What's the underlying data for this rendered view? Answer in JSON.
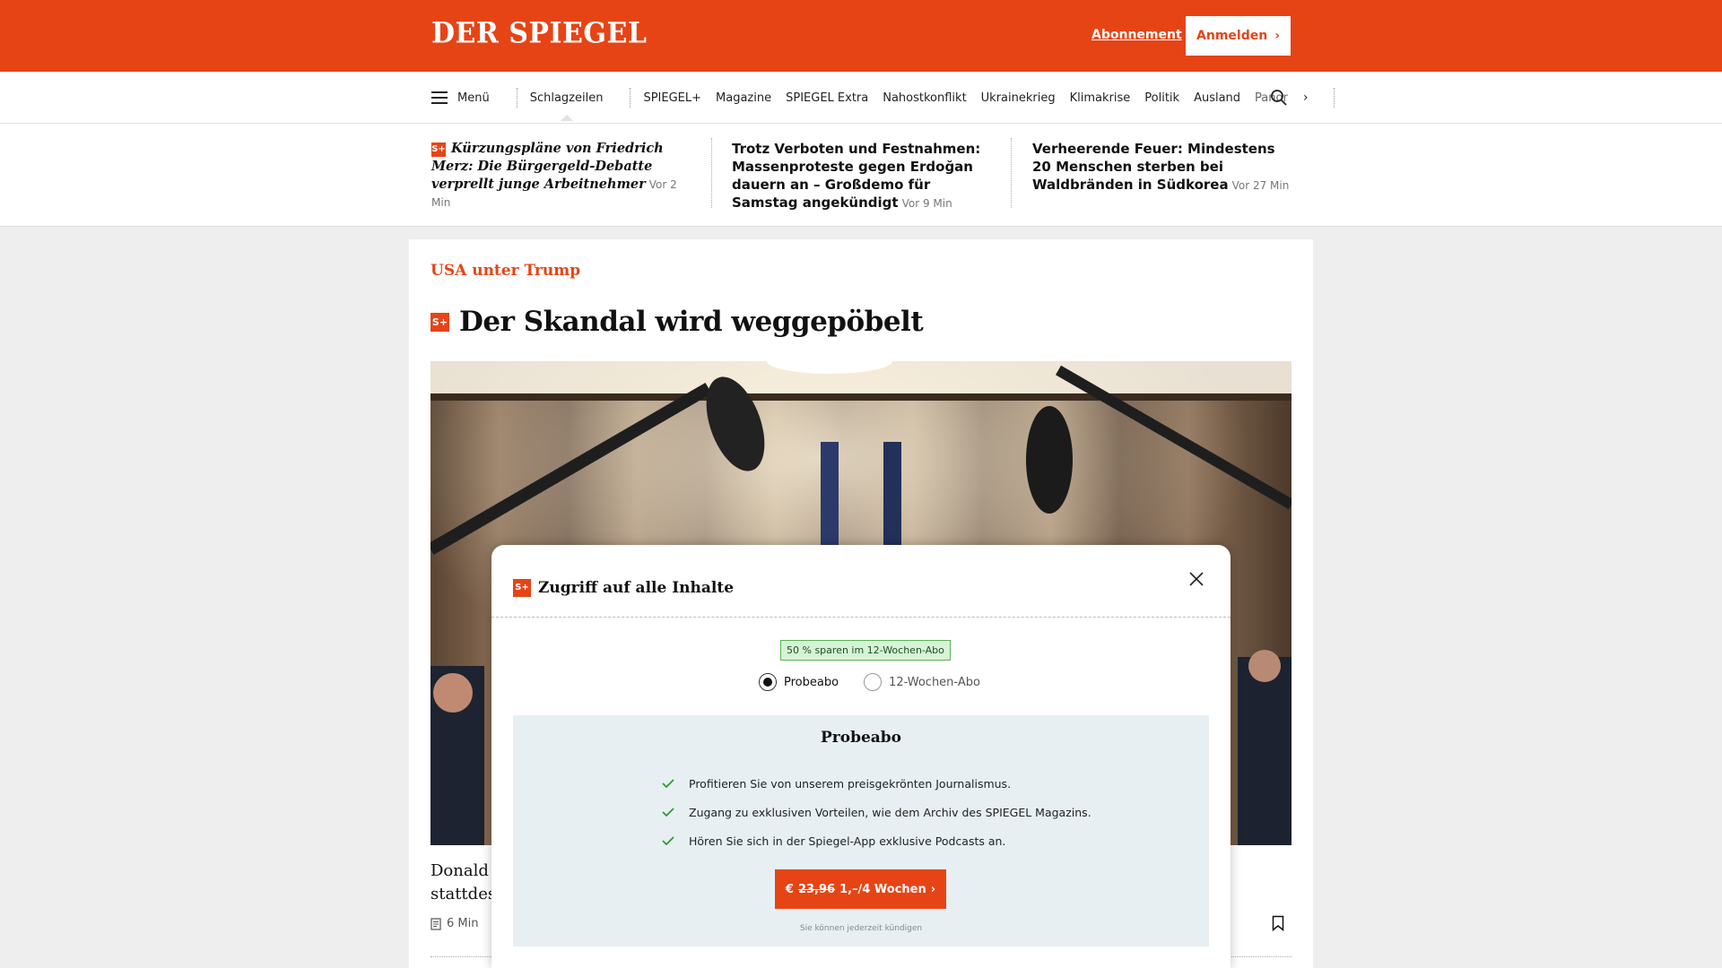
{
  "header": {
    "logo": "DER SPIEGEL",
    "subscription_link": "Abonnement",
    "login_button": "Anmelden"
  },
  "nav": {
    "menu_label": "Menü",
    "items": [
      "Schlagzeilen",
      "SPIEGEL+",
      "Magazine",
      "SPIEGEL Extra",
      "Nahostkonflikt",
      "Ukrainekrieg",
      "Klimakrise",
      "Politik",
      "Ausland",
      "Panor"
    ]
  },
  "teasers": [
    {
      "badge": "S+",
      "title": "Kürzungspläne von Friedrich Merz: Die Bürgergeld-Debatte verprellt junge Arbeitnehmer",
      "time": "Vor 2 Min"
    },
    {
      "title": "Trotz Verboten und Festnahmen: Massenproteste gegen Erdoğan dauern an – Großdemo für Samstag angekündigt",
      "time": "Vor 9 Min"
    },
    {
      "title": "Verheerende Feuer: Mindestens 20 Menschen sterben bei Waldbränden in Südkorea",
      "time": "Vor 27 Min"
    }
  ],
  "article": {
    "kicker": "USA unter Trump",
    "badge": "S+",
    "headline": "Der Skandal wird weggepöbelt",
    "lead_line1": "Donald T",
    "lead_line2": "stattdess",
    "read_time": "6 Min"
  },
  "modal": {
    "badge": "S+",
    "title": "Zugriff auf alle Inhalte",
    "savings_badge": "50 % sparen im 12-Wochen-Abo",
    "options": [
      {
        "label": "Probeabo",
        "selected": true
      },
      {
        "label": "12-Wochen-Abo",
        "selected": false
      }
    ],
    "plan_title": "Probeabo",
    "benefits": [
      "Profitieren Sie von unserem preisgekrönten Journalismus.",
      "Zugang zu exklusiven Vorteilen, wie dem Archiv des SPIEGEL Magazins.",
      "Hören Sie sich in der Spiegel-App exklusive Podcasts an."
    ],
    "cta_currency": "€",
    "cta_old_price": "23,96",
    "cta_new_price": "1,–/4 Wochen",
    "cancel_note": "Sie können jederzeit kündigen"
  },
  "colors": {
    "brand": "#e64415",
    "plan_box": "#e7eff3",
    "savings_bg": "#d6f3d6",
    "check": "#2e9a2e"
  },
  "icons": [
    "menu-icon",
    "search-icon",
    "chevron-right-icon",
    "close-icon",
    "check-icon",
    "bookmark-icon",
    "article-icon"
  ]
}
